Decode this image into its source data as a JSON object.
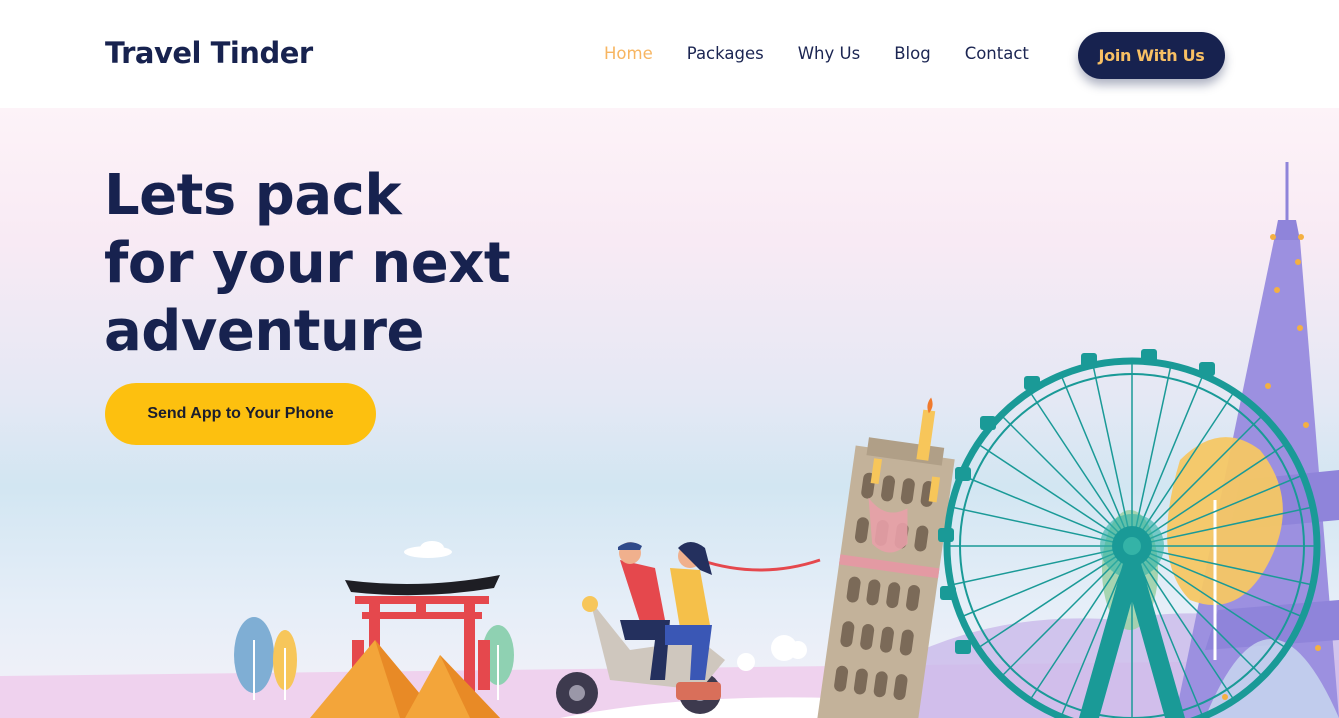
{
  "header": {
    "logo": "Travel Tinder",
    "nav": [
      {
        "label": "Home",
        "active": true
      },
      {
        "label": "Packages",
        "active": false
      },
      {
        "label": "Why Us",
        "active": false
      },
      {
        "label": "Blog",
        "active": false
      },
      {
        "label": "Contact",
        "active": false
      }
    ],
    "join_button": "Join With Us"
  },
  "hero": {
    "title_lines": [
      "Lets pack",
      "for your next",
      "adventure"
    ],
    "cta_button": "Send App to Your Phone"
  },
  "top_progress": 0.2,
  "colors": {
    "navy": "#17224f",
    "accent_orange": "#f7b561",
    "cta_yellow": "#fdc00f",
    "ferris_teal": "#1a9a97",
    "tower_purple": "#8f84da"
  },
  "icons": [
    "torii-gate",
    "pyramids",
    "scooter-couple",
    "leaning-tower",
    "ferris-wheel",
    "eiffel-tower",
    "trees",
    "clouds"
  ]
}
